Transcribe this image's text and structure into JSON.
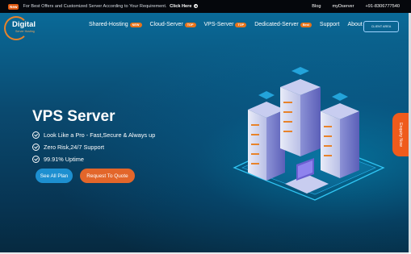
{
  "topbar": {
    "badge": "New",
    "promo_text": "For Best Offers and Customized Server According to Your Requirement.",
    "cta": "Click Here",
    "links": [
      "Blog",
      "myDserver",
      "+91-8306777540"
    ]
  },
  "brand": {
    "name": "Digital",
    "tagline": "Server Hosting"
  },
  "nav": [
    {
      "label": "Shared-Hosting",
      "tag": "NEW"
    },
    {
      "label": "Cloud-Server",
      "tag": "TOP"
    },
    {
      "label": "VPS-Server",
      "tag": "TOP"
    },
    {
      "label": "Dedicated-Server",
      "tag": "Best"
    },
    {
      "label": "Support",
      "tag": ""
    },
    {
      "label": "About",
      "tag": ""
    }
  ],
  "client_area": "CLIENT AREA",
  "hero": {
    "title": "VPS Server",
    "features": [
      "Look Like a Pro - Fast,Secure & Always up",
      "Zero Risk,24/7 Support",
      "99.91% Uptime"
    ],
    "buttons": {
      "primary": "See All Plan",
      "secondary": "Request To Quote"
    }
  },
  "enquiry": "Enquiry Now",
  "colors": {
    "accent": "#e3662a",
    "primary": "#1d8fd0",
    "bg": "#0a4a70"
  }
}
